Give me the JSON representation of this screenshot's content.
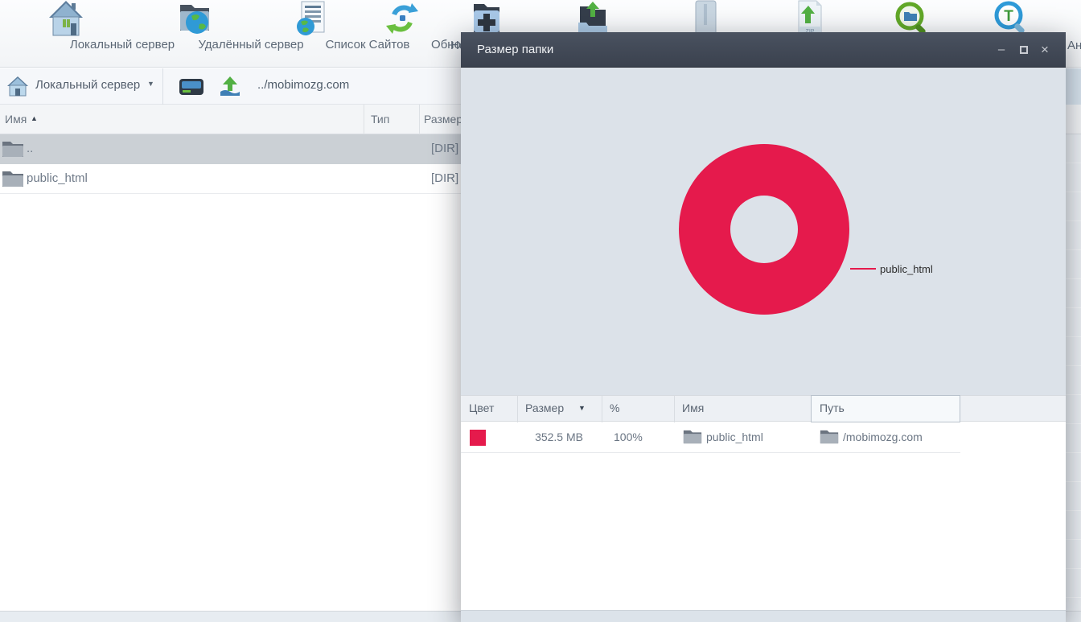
{
  "colors": {
    "accent_red": "#e51a4c",
    "titlebar": "#3f4653",
    "dialog_body": "#dce2e9",
    "selected_row": "#cbd0d5"
  },
  "toolbar": {
    "buttons": [
      {
        "label": "Локальный сервер",
        "icon": "local-server-icon"
      },
      {
        "label": "Удалённый сервер",
        "icon": "remote-server-icon"
      },
      {
        "label": "Список Сайтов",
        "icon": "sites-list-icon"
      },
      {
        "label": "Обновить",
        "icon": "refresh-icon"
      },
      {
        "label": "",
        "icon": "new-folder-icon"
      },
      {
        "label": "",
        "icon": "upload-folder-icon"
      },
      {
        "label": "",
        "icon": "archive-icon"
      },
      {
        "label": "",
        "icon": "zip-download-icon"
      },
      {
        "label": "",
        "icon": "search-folder-icon"
      },
      {
        "label": "",
        "icon": "search-text-icon"
      }
    ],
    "clipped_label_new": "Но",
    "clipped_label_right": "Ан",
    "zip_badge": "ZIP",
    "t_badge": "T"
  },
  "pathbar": {
    "server_label": "Локальный сервер",
    "dropdown_icon": "▼",
    "path": "../mobimozg.com"
  },
  "file_list": {
    "columns": {
      "name": "Имя",
      "type": "Тип",
      "size": "Размер"
    },
    "sort_icon": "▲",
    "rows": [
      {
        "name": "..",
        "type": "",
        "size": "[DIR]"
      },
      {
        "name": "public_html",
        "type": "",
        "size": "[DIR]"
      }
    ]
  },
  "dialog": {
    "title": "Размер папки",
    "window_controls": {
      "minimize": "–",
      "close": "×"
    },
    "chart_label": "public_html",
    "table": {
      "columns": {
        "color": "Цвет",
        "size": "Размер",
        "percent": "%",
        "name": "Имя",
        "path": "Путь"
      },
      "sort_icon": "▼",
      "rows": [
        {
          "color": "#e51a4c",
          "size": "352.5 MB",
          "percent": "100%",
          "name": "public_html",
          "path": "/mobimozg.com"
        }
      ]
    }
  },
  "chart_data": {
    "type": "pie",
    "donut": true,
    "title": "Размер папки",
    "labels": [
      "public_html"
    ],
    "values": [
      352.5
    ],
    "unit": "MB",
    "percents": [
      100
    ],
    "colors": [
      "#e51a4c"
    ],
    "legend_position": "right-leader-line"
  }
}
